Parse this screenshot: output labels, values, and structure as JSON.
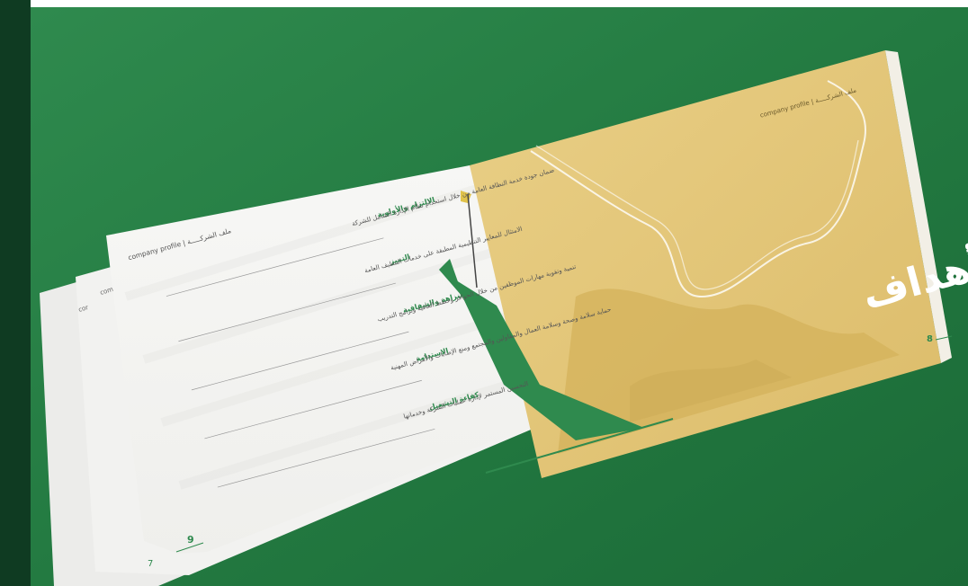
{
  "photo": {
    "background_color": "#2a7a45",
    "left_page": {
      "header": "company profile | ملف الشركـــــة",
      "rows": [
        {
          "label": "الالتزام والأولوية",
          "text": "ضمان جودة خدمة النظافة العامة من خلال استخدام نظام الإدارة الشامل للشركة"
        },
        {
          "label": "التميز",
          "text": "الامتثال للمعايير التنظيمية المطبقة على خدمات التنظيف العامة"
        },
        {
          "label": "النزاهة والشفافية",
          "text": "تنمية وتقوية مهارات الموظفين من خلال الحوافز وخطط العافية وبرامج التدريب"
        },
        {
          "label": "الاستدامة",
          "text": "حماية سلامة وصحة وسلامة العمال والمقاولين والمجتمع ومنع الإصابات والأمراض المهنية"
        },
        {
          "label": "كفاءة التشغيل",
          "text": "التحسين المستمر لإدارة عمليات الشركة وخدماتها"
        }
      ],
      "page_number": "9",
      "under_page_number": "7",
      "back_page_fragments": [
        "compa",
        "cor"
      ]
    },
    "right_page": {
      "header": "company profile | ملف الشركـــــة",
      "title": "الأهداف",
      "page_number": "8"
    }
  }
}
